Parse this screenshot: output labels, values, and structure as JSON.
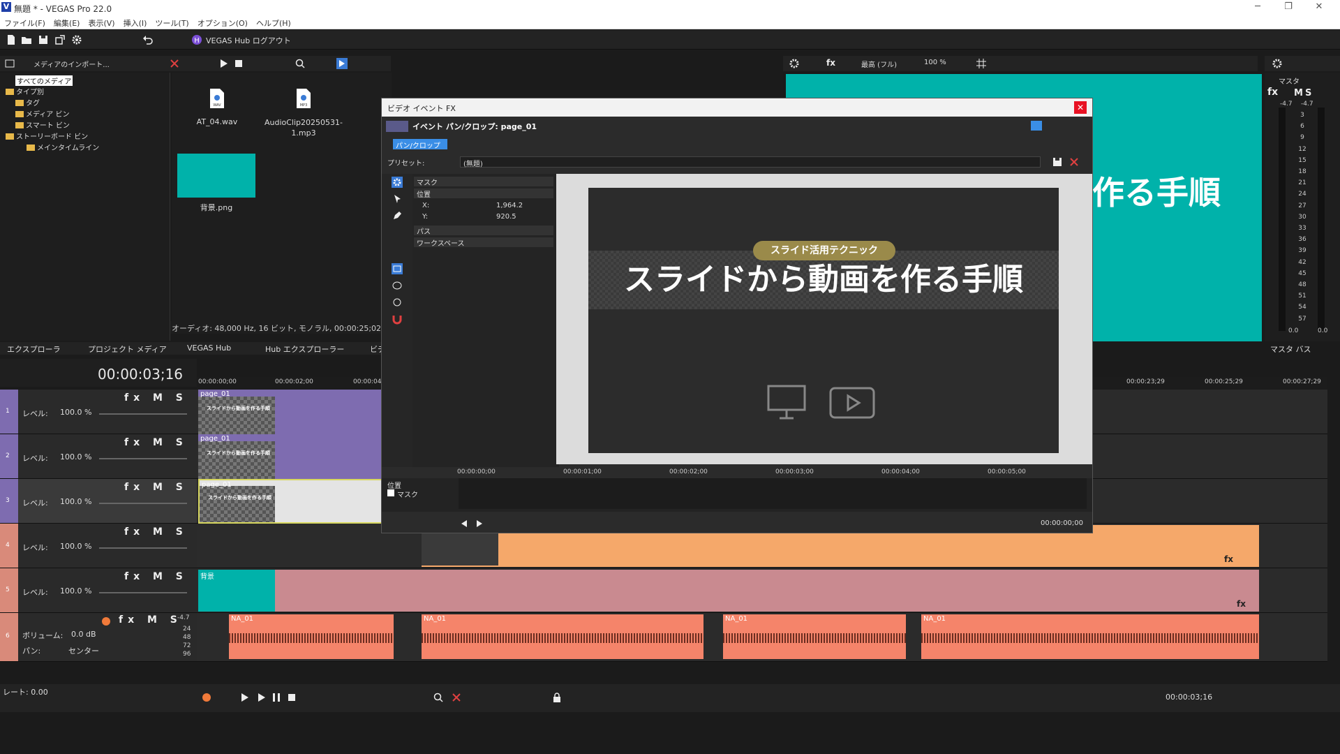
{
  "window": {
    "title": "無題 * - VEGAS Pro 22.0",
    "logo": "V"
  },
  "menu": [
    "ファイル(F)",
    "編集(E)",
    "表示(V)",
    "挿入(I)",
    "ツール(T)",
    "オプション(O)",
    "ヘルプ(H)"
  ],
  "toolbar": {
    "hub_label": "VEGAS Hub ログアウト",
    "import_label": "メディアのインポート..."
  },
  "explorer": {
    "tree": [
      "すべてのメディア",
      "タイプ別",
      "タグ",
      "メディア ビン",
      "スマート ビン",
      "ストーリーボード ビン",
      "メインタイムライン"
    ],
    "media": [
      {
        "name": "AT_04.wav",
        "type": "WAV"
      },
      {
        "name": "AudioClip20250531-1.mp3",
        "type": "MP3"
      },
      {
        "name": "背景.png",
        "type": "png"
      }
    ],
    "status": "オーディオ: 48,000 Hz, 16 ビット, モノラル, 00:00:25;02, 非圧",
    "tabs": [
      "エクスプローラ",
      "プロジェクト メディア",
      "VEGAS Hub",
      "Hub エクスプローラー",
      "ビデ"
    ]
  },
  "preview": {
    "quality": "最高 (フル)",
    "zoom": "100 %",
    "title_fragment": "作る手順",
    "bg_color": "#00b2aa"
  },
  "master": {
    "label": "マスタ",
    "mute": "M",
    "solo": "S",
    "peaks": [
      "-4.7",
      "-4.7"
    ],
    "scale": [
      "3",
      "6",
      "9",
      "12",
      "15",
      "18",
      "21",
      "24",
      "27",
      "30",
      "33",
      "36",
      "39",
      "42",
      "45",
      "48",
      "51",
      "54",
      "57"
    ],
    "bottom_values": [
      "0.0",
      "0.0"
    ],
    "bus_label": "マスタ バス"
  },
  "timeline": {
    "current_time": "00:00:03;16",
    "ruler": [
      "00:00:00;00",
      "00:00:02;00",
      "00:00:04",
      "00:00:23;29",
      "00:00:25;29",
      "00:00:27;29"
    ],
    "tracks": [
      {
        "num": "1",
        "level_label": "レベル:",
        "level": "100.0 %",
        "clip": "page_01"
      },
      {
        "num": "2",
        "level_label": "レベル:",
        "level": "100.0 %",
        "clip": "page_01"
      },
      {
        "num": "3",
        "level_label": "レベル:",
        "level": "100.0 %",
        "clip": "page_01"
      },
      {
        "num": "4",
        "level_label": "レベル:",
        "level": "100.0 %",
        "clip": ""
      },
      {
        "num": "5",
        "level_label": "レベル:",
        "level": "100.0 %",
        "clip": "背景"
      }
    ],
    "audio": {
      "num": "6",
      "volume_label": "ボリューム:",
      "volume": "0.0 dB",
      "pan_label": "パン:",
      "pan": "センター",
      "peak": "-4.7",
      "scale": [
        "24",
        "48",
        "72",
        "96"
      ],
      "clips": [
        "NA_01",
        "NA_01",
        "NA_01",
        "NA_01"
      ]
    },
    "thumb_title": "スライドから動画を作る手順"
  },
  "dialog": {
    "title": "ビデオ イベント FX",
    "subtitle": "イベント パン/クロップ: page_01",
    "tab": "パン/クロップ",
    "preset_label": "プリセット:",
    "preset_value": "(無題)",
    "props": {
      "mask": "マスク",
      "position": "位置",
      "x_label": "X:",
      "x_value": "1,964.2",
      "y_label": "Y:",
      "y_value": "920.5",
      "path": "パス",
      "workspace": "ワークスペース"
    },
    "canvas": {
      "pill": "スライド活用テクニック",
      "title": "スライドから動画を作る手順"
    },
    "kf_ruler": [
      "00:00:00;00",
      "00:00:01;00",
      "00:00:02;00",
      "00:00:03;00",
      "00:00:04;00",
      "00:00:05;00"
    ],
    "kf_rows": [
      "位置",
      "マスク"
    ],
    "kf_time": "00:00:00;00"
  },
  "transport": {
    "rate": "レート: 0.00",
    "time": "00:00:03;16"
  }
}
